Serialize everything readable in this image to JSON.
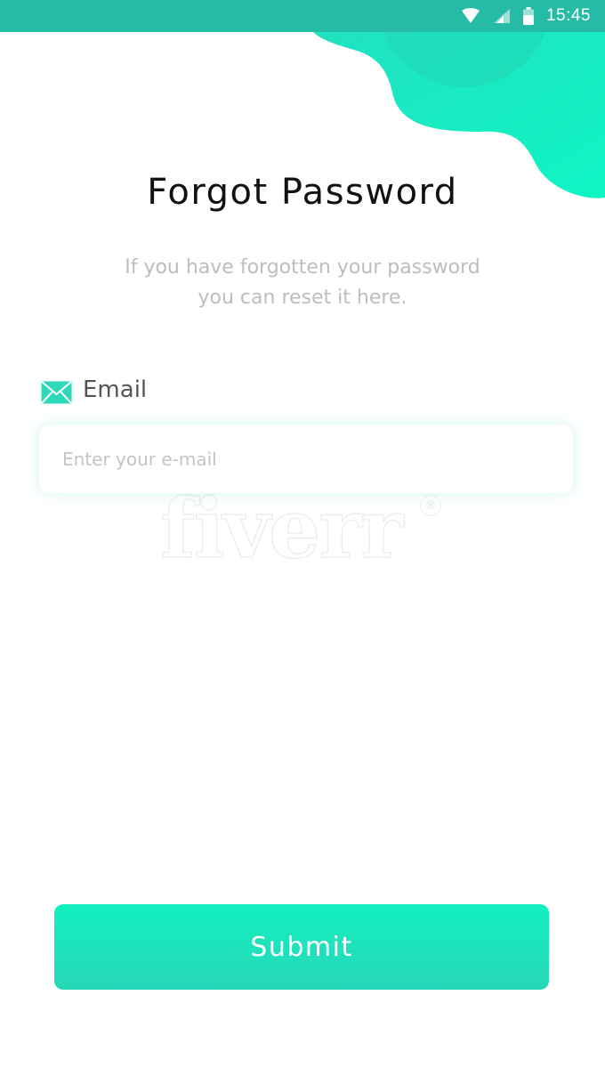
{
  "status_bar": {
    "time": "15:45",
    "icons": [
      "wifi-icon",
      "signal-icon",
      "battery-icon"
    ]
  },
  "page": {
    "title": "Forgot Password",
    "subtitle_line1": "If you have forgotten your password",
    "subtitle_line2": "you can reset it here."
  },
  "email_field": {
    "label": "Email",
    "icon": "mail-icon",
    "placeholder": "Enter your e-mail",
    "value": ""
  },
  "watermark": {
    "text": "fiverr",
    "mark": "®"
  },
  "actions": {
    "submit_label": "Submit"
  },
  "colors": {
    "status_bar": "#26bba4",
    "accent_light": "#12f0bf",
    "accent_dark": "#27d6b8",
    "title": "#111111",
    "subtitle": "#bdbdbd",
    "placeholder": "#c4c4c4"
  }
}
